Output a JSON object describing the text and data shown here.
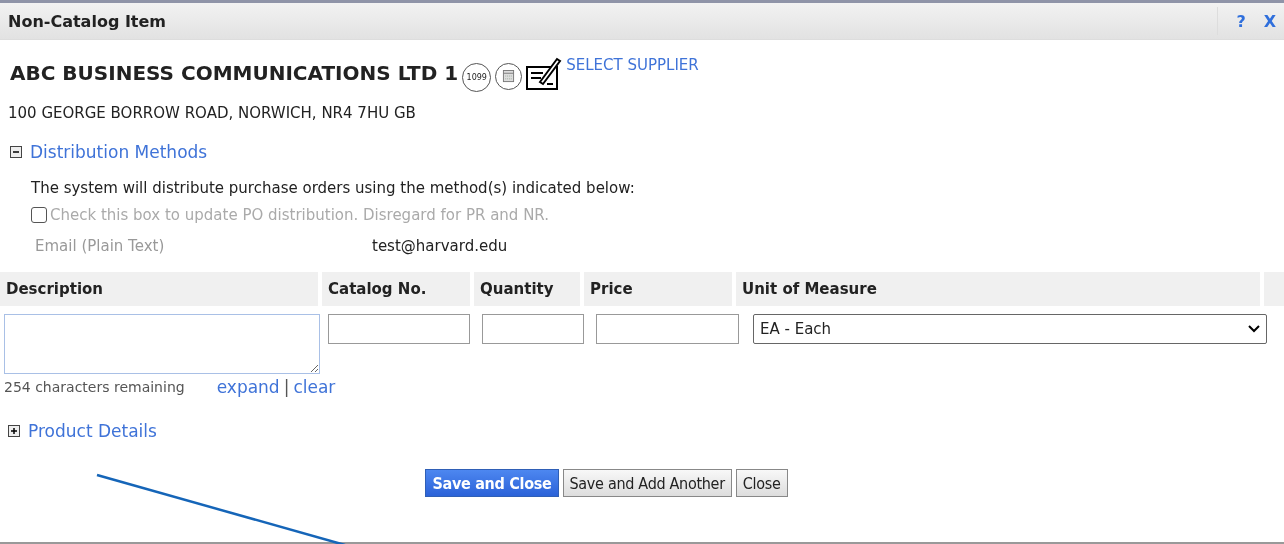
{
  "window": {
    "title": "Non-Catalog Item",
    "help": "?",
    "close": "X"
  },
  "supplier": {
    "name": "ABC BUSINESS COMMUNICATIONS LTD 1",
    "badge": "1099",
    "select_link": "SELECT SUPPLIER",
    "address": "100 GEORGE BORROW ROAD, NORWICH, NR4 7HU GB"
  },
  "distribution": {
    "title": "Distribution Methods",
    "expanded": true,
    "note": "The system will distribute purchase orders using the method(s) indicated below:",
    "checkbox": {
      "label": "Check this box to update PO distribution. Disregard for PR and NR.",
      "checked": false,
      "disabled": true
    },
    "method_label": "Email (Plain Text)",
    "method_value": "test@harvard.edu"
  },
  "table": {
    "columns": [
      "Description",
      "Catalog No.",
      "Quantity",
      "Price",
      "Unit of Measure"
    ],
    "unit_value": "EA - Each",
    "remaining": "254 characters remaining",
    "links": [
      "expand",
      "clear"
    ],
    "separator": "|"
  },
  "product_details": {
    "title": "Product Details",
    "expanded": false
  },
  "buttons": [
    {
      "label": "Save and Close",
      "kind": "primary"
    },
    {
      "label": "Save and Add Another",
      "kind": "secondary"
    },
    {
      "label": "Close",
      "kind": "secondary"
    }
  ]
}
